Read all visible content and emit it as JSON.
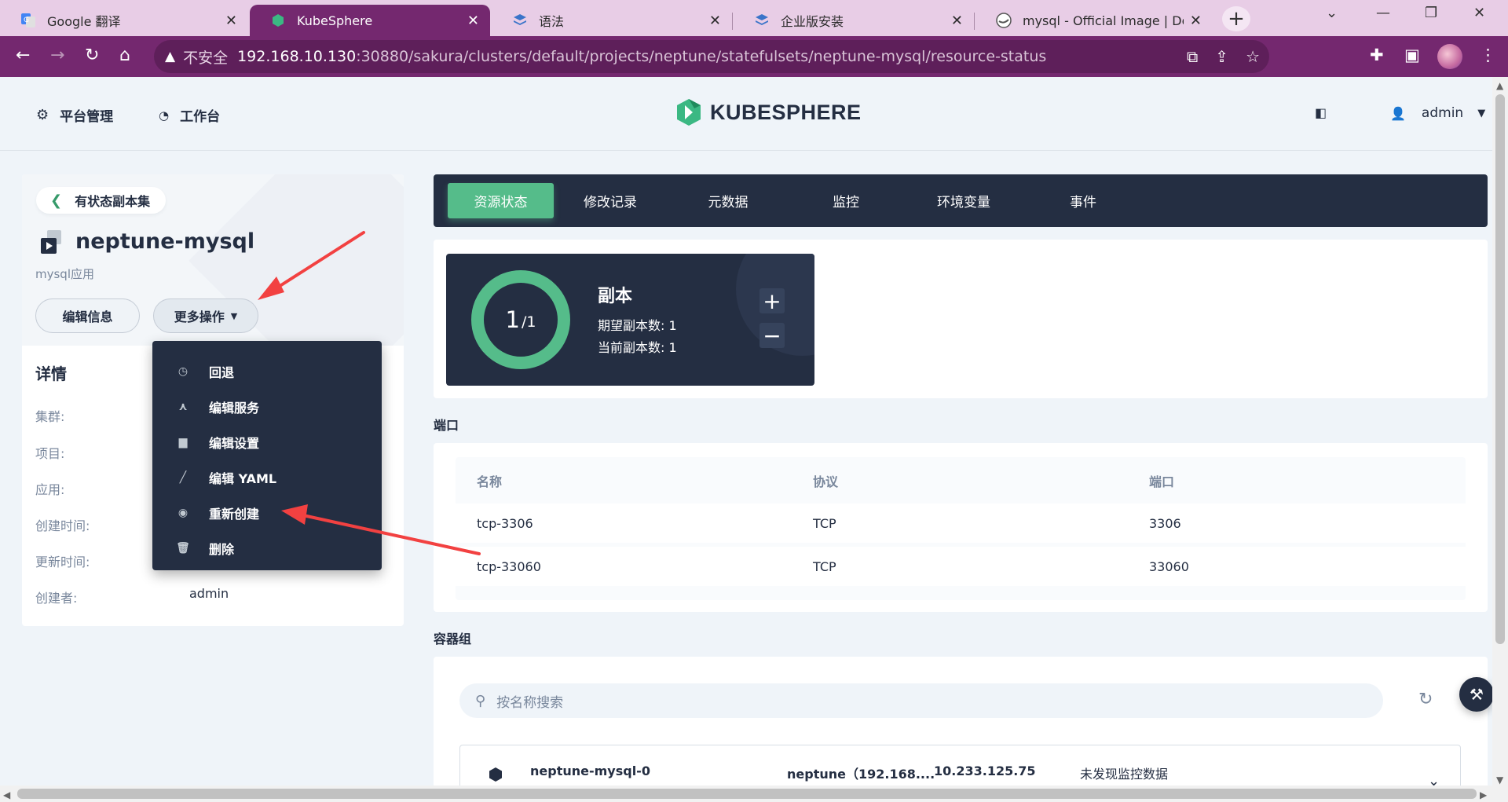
{
  "browser": {
    "tabs": [
      {
        "label": "Google 翻译",
        "icon": "google-translate-icon"
      },
      {
        "label": "KubeSphere",
        "icon": "kubesphere-icon",
        "active": true
      },
      {
        "label": "语法",
        "icon": "layers-icon"
      },
      {
        "label": "企业版安装",
        "icon": "layers-icon"
      },
      {
        "label": "mysql - Official Image | Dock",
        "icon": "docker-icon"
      }
    ],
    "address": {
      "insecure_label": "不安全",
      "host": "192.168.10.130",
      "path": ":30880/sakura/clusters/default/projects/neptune/statefulsets/neptune-mysql/resource-status"
    }
  },
  "header": {
    "platform_label": "平台管理",
    "workbench_label": "工作台",
    "logo_text": "KUBESPHERE",
    "user": "admin"
  },
  "left": {
    "back_label": "有状态副本集",
    "resource_name": "neptune-mysql",
    "resource_desc": "mysql应用",
    "edit_button": "编辑信息",
    "more_button": "更多操作",
    "details_title": "详情",
    "details": [
      {
        "label": "集群:",
        "value": ""
      },
      {
        "label": "项目:",
        "value": ""
      },
      {
        "label": "应用:",
        "value": ""
      },
      {
        "label": "创建时间:",
        "value": ""
      },
      {
        "label": "更新时间:",
        "value": ""
      },
      {
        "label": "创建者:",
        "value": "admin"
      }
    ]
  },
  "menu": {
    "items": [
      {
        "label": "回退",
        "icon": "history-icon"
      },
      {
        "label": "编辑服务",
        "icon": "service-icon"
      },
      {
        "label": "编辑设置",
        "icon": "storage-icon"
      },
      {
        "label": "编辑 YAML",
        "icon": "pen-icon"
      },
      {
        "label": "重新创建",
        "icon": "restart-icon"
      },
      {
        "label": "删除",
        "icon": "trash-icon"
      }
    ]
  },
  "tabs": [
    "资源状态",
    "修改记录",
    "元数据",
    "监控",
    "环境变量",
    "事件"
  ],
  "replica": {
    "current": "1",
    "desired_fraction": "/1",
    "title": "副本",
    "desired_label": "期望副本数: 1",
    "current_label": "当前副本数: 1"
  },
  "ports": {
    "title": "端口",
    "headers": [
      "名称",
      "协议",
      "端口"
    ],
    "rows": [
      [
        "tcp-3306",
        "TCP",
        "3306"
      ],
      [
        "tcp-33060",
        "TCP",
        "33060"
      ]
    ]
  },
  "pods": {
    "title": "容器组",
    "search_placeholder": "按名称搜索",
    "row": {
      "name": "neptune-mysql-0",
      "node": "neptune（192.168....",
      "ip": "10.233.125.75",
      "monitor": "未发现监控数据"
    }
  },
  "colors": {
    "accent_green": "#55bc8a",
    "dark_navy": "#242e42",
    "browser_purple": "#74286f",
    "annotation_red": "#f24141"
  }
}
